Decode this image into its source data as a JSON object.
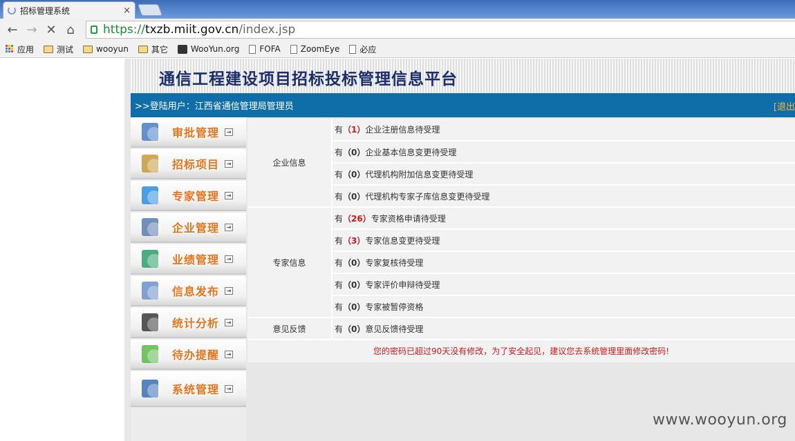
{
  "browser": {
    "tab_title": "招标管理系统",
    "tab_close": "×",
    "back": "←",
    "forward": "→",
    "reload": "✕",
    "home": "⌂",
    "url_scheme": "https://",
    "url_host": "txzb.miit.gov.cn",
    "url_path": "/index.jsp",
    "bookmarks": [
      {
        "label": "应用",
        "icon": "apps-icon"
      },
      {
        "label": "测试",
        "icon": "folder-icon"
      },
      {
        "label": "wooyun",
        "icon": "folder-icon"
      },
      {
        "label": "其它",
        "icon": "folder-icon"
      },
      {
        "label": "WooYun.org",
        "icon": "wooyun-icon"
      },
      {
        "label": "FOFA",
        "icon": "page-icon"
      },
      {
        "label": "ZoomEye",
        "icon": "page-icon"
      },
      {
        "label": "必应",
        "icon": "page-icon"
      }
    ]
  },
  "header": {
    "title": "通信工程建设项目招标投标管理信息平台",
    "user_line": ">>登陆用户：江西省通信管理局管理员",
    "logout": "[退出"
  },
  "sidebar": {
    "items": [
      {
        "label": "审批管理",
        "icon": "approval-icon"
      },
      {
        "label": "招标项目",
        "icon": "tender-project-icon"
      },
      {
        "label": "专家管理",
        "icon": "expert-icon"
      },
      {
        "label": "企业管理",
        "icon": "enterprise-icon"
      },
      {
        "label": "业绩管理",
        "icon": "performance-icon"
      },
      {
        "label": "信息发布",
        "icon": "publish-icon"
      },
      {
        "label": "统计分析",
        "icon": "statistics-icon"
      },
      {
        "label": "待办提醒",
        "icon": "reminder-icon"
      },
      {
        "label": "系统管理",
        "icon": "system-gear-icon"
      }
    ],
    "arrow": "⇥"
  },
  "tasks": {
    "groups": [
      {
        "category": "企业信息",
        "rows": [
          {
            "prefix": "有",
            "count": "（1）",
            "hot": true,
            "text": "企业注册信息待受理"
          },
          {
            "prefix": "有",
            "count": "（0）",
            "hot": false,
            "text": "企业基本信息变更待受理"
          },
          {
            "prefix": "有",
            "count": "（0）",
            "hot": false,
            "text": "代理机构附加信息变更待受理"
          },
          {
            "prefix": "有",
            "count": "（0）",
            "hot": false,
            "text": "代理机构专家子库信息变更待受理"
          }
        ]
      },
      {
        "category": "专家信息",
        "rows": [
          {
            "prefix": "有",
            "count": "（26）",
            "hot": true,
            "text": "专家资格申请待受理"
          },
          {
            "prefix": "有",
            "count": "（3）",
            "hot": true,
            "text": "专家信息变更待受理"
          },
          {
            "prefix": "有",
            "count": "（0）",
            "hot": false,
            "text": "专家复核待受理"
          },
          {
            "prefix": "有",
            "count": "（0）",
            "hot": false,
            "text": "专家评价申辩待受理"
          },
          {
            "prefix": "有",
            "count": "（0）",
            "hot": false,
            "text": "专家被暂停资格"
          }
        ]
      },
      {
        "category": "意见反馈",
        "rows": [
          {
            "prefix": "有",
            "count": "（0）",
            "hot": false,
            "text": "意见反馈待受理"
          }
        ]
      }
    ],
    "notice": "您的密码已超过90天没有修改，为了安全起见，建议您去系统管理里面修改密码!"
  },
  "watermark": "www.wooyun.org",
  "colors": {
    "user_bar": "#0f6ea8",
    "menu_label": "#e2751e",
    "hot_count": "#d01717",
    "notice": "#cc1a1a",
    "title": "#1c2d6b"
  }
}
